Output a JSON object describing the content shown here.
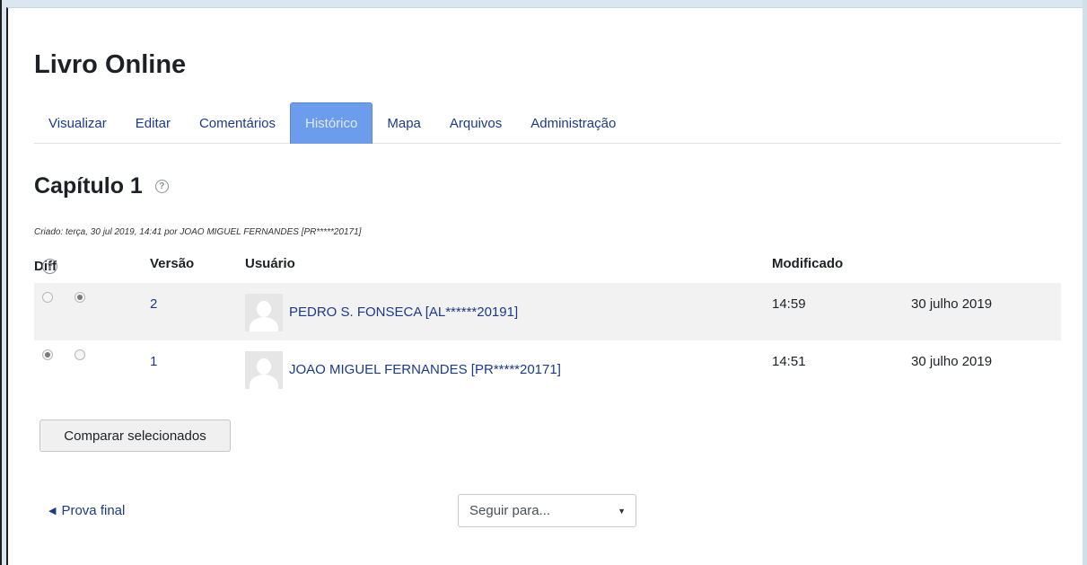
{
  "page": {
    "title": "Livro Online",
    "chapter_title": "Capítulo 1",
    "created_text": "Criado: terça, 30 jul 2019, 14:41 por JOAO MIGUEL FERNANDES [PR*****20171]"
  },
  "tabs": [
    {
      "label": "Visualizar",
      "active": false
    },
    {
      "label": "Editar",
      "active": false
    },
    {
      "label": "Comentários",
      "active": false
    },
    {
      "label": "Histórico",
      "active": true
    },
    {
      "label": "Mapa",
      "active": false
    },
    {
      "label": "Arquivos",
      "active": false
    },
    {
      "label": "Administração",
      "active": false
    }
  ],
  "table": {
    "headers": {
      "diff": "Diff",
      "version": "Versão",
      "user": "Usuário",
      "modified": "Modificado"
    },
    "rows": [
      {
        "version": "2",
        "user": "PEDRO S. FONSECA [AL******20191]",
        "time": "14:59",
        "date": "30 julho 2019",
        "radio_left_checked": false,
        "radio_right_checked": true
      },
      {
        "version": "1",
        "user": "JOAO MIGUEL FERNANDES [PR*****20171]",
        "time": "14:51",
        "date": "30 julho 2019",
        "radio_left_checked": true,
        "radio_right_checked": false
      }
    ]
  },
  "actions": {
    "compare_label": "Comparar selecionados",
    "prev_link_label": "Prova final",
    "jump_placeholder": "Seguir para..."
  },
  "colors": {
    "active_tab": "#6c9dec",
    "link": "#1a3a8a",
    "row_shade": "#f2f2f2"
  }
}
